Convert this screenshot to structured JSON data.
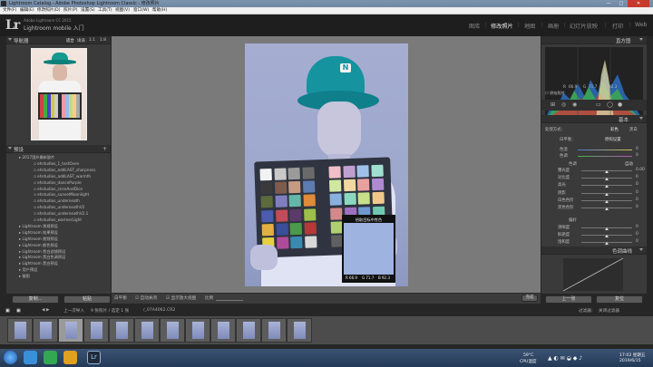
{
  "window": {
    "title": "Lightroom Catalog - Adobe Photoshop Lightroom Classic - 修改照片",
    "min": "—",
    "max": "□",
    "close": "✕"
  },
  "menu": [
    "文件(F)",
    "编辑(E)",
    "修改照片(D)",
    "照片(P)",
    "设置(S)",
    "工具(T)",
    "视图(V)",
    "窗口(W)",
    "帮助(H)"
  ],
  "identity": {
    "logo": "Lr",
    "cc": "Adobe Lightroom CC 2015",
    "mobile": "Lightroom mobile 入门"
  },
  "modules": [
    "图库",
    "修改照片",
    "地图",
    "画册",
    "幻灯片放映",
    "打印",
    "Web"
  ],
  "active_module": "修改照片",
  "navigator": {
    "title": "导航器",
    "options": [
      "适合",
      "填满",
      "1:1",
      "1:8"
    ]
  },
  "presets": {
    "title": "预设",
    "items": [
      {
        "label": "2017国外最新胶片",
        "level": 0
      },
      {
        "label": "ehstudios_1_testOven",
        "level": 1
      },
      {
        "label": "ehstudios_addLAST_sharpness",
        "level": 1
      },
      {
        "label": "ehstudios_addLAST_warmth",
        "level": 1
      },
      {
        "label": "ehstudios_dancePurple",
        "level": 1
      },
      {
        "label": "ehstudios_circeAndDice",
        "level": 1
      },
      {
        "label": "ehstudios_sunsetMoonlight",
        "level": 1
      },
      {
        "label": "ehstudios_underneath",
        "level": 1
      },
      {
        "label": "ehstudios_underneathV2",
        "level": 1
      },
      {
        "label": "ehstudios_underneathV2.1",
        "level": 1
      },
      {
        "label": "ehstudios_warmerLight",
        "level": 1
      },
      {
        "label": "Lightroom 常规预设",
        "level": 0
      },
      {
        "label": "Lightroom 效果预设",
        "level": 0
      },
      {
        "label": "Lightroom 视频预设",
        "level": 0
      },
      {
        "label": "Lightroom 颜色预设",
        "level": 0
      },
      {
        "label": "Lightroom 黑白滤镜预设",
        "level": 0
      },
      {
        "label": "Lightroom 黑白色调预设",
        "level": 0
      },
      {
        "label": "Lightroom 黑白预设",
        "level": 0
      },
      {
        "label": "用户预设",
        "level": 0
      },
      {
        "label": "截图",
        "level": 0
      }
    ]
  },
  "left_buttons": {
    "copy": "复制...",
    "paste": "粘贴"
  },
  "histogram": {
    "title": "直方图",
    "r_label": "R",
    "r": "66.9",
    "g_label": "G",
    "g": "71.7",
    "b_label": "B",
    "b": "92.3",
    "original": "原始照片"
  },
  "basic": {
    "title": "基本",
    "treatment": "处理方式：",
    "color": "彩色",
    "bw": "黑白",
    "wb_label": "白平衡：",
    "wb_value": "原照设置",
    "temp_label": "色温",
    "temp_value": "0",
    "tint_label": "色调",
    "tint_value": "0",
    "tone_label": "色调",
    "auto": "自动",
    "sliders": [
      {
        "label": "曝光度",
        "value": "0.00"
      },
      {
        "label": "对比度",
        "value": "0"
      },
      {
        "label": "高光",
        "value": "0"
      },
      {
        "label": "阴影",
        "value": "0"
      },
      {
        "label": "白色色阶",
        "value": "0"
      },
      {
        "label": "黑色色阶",
        "value": "0"
      }
    ],
    "presence": "偏好",
    "presence_sliders": [
      {
        "label": "清晰度",
        "value": "0"
      },
      {
        "label": "鲜艳度",
        "value": "0"
      },
      {
        "label": "饱和度",
        "value": "0"
      }
    ]
  },
  "tone_curve": {
    "title": "色调曲线"
  },
  "right_buttons": {
    "prev": "上一张",
    "reset": "复位"
  },
  "color_picker": {
    "title": "拾取目标中性色",
    "r": "R 66.9",
    "g": "G 71.7",
    "b": "B 92.3"
  },
  "toolbar": {
    "wb_tool": "白平衡",
    "auto_dismiss": "自动关闭",
    "show_loupe": "显示放大视图",
    "scale": "比例",
    "done": "完成"
  },
  "filmstrip_bar": {
    "prev_import": "上一次导入",
    "count": "9 张照片 / 选定 1 张",
    "filename": "/_07A4062.CR2",
    "filter_label": "过滤器：",
    "filter_value": "关闭过滤器"
  },
  "taskbar": {
    "weather_temp": "59°C",
    "weather_cpu": "CPU温度",
    "time": "17:02 星期五",
    "date": "2019/6/15"
  },
  "colors": {
    "accent": "#e8e8e8",
    "hat": "#12929e",
    "photo_bg": "#a5aed1"
  }
}
